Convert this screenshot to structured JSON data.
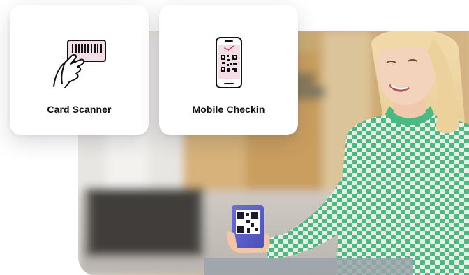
{
  "cards": [
    {
      "label": "Card Scanner",
      "icon": "card-scanner-icon"
    },
    {
      "label": "Mobile Checkin",
      "icon": "mobile-qr-checkin-icon"
    }
  ],
  "colors": {
    "accent_pink": "#f3dde6",
    "accent_red": "#e0344f",
    "card_background": "#ffffff",
    "label_text": "#111111"
  }
}
